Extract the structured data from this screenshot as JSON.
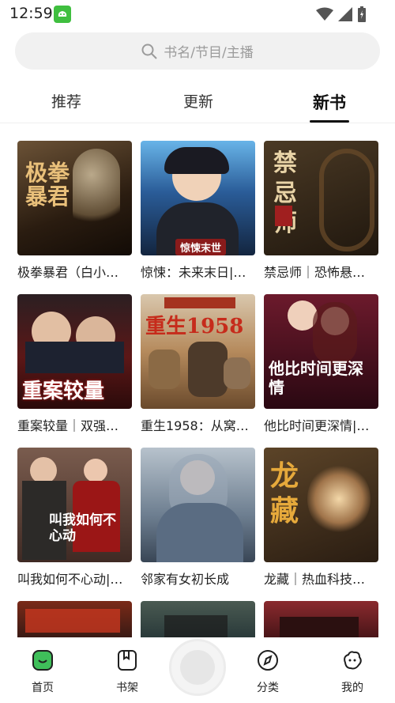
{
  "status": {
    "time": "12:59"
  },
  "search": {
    "placeholder": "书名/节目/主播"
  },
  "tabs": [
    {
      "label": "推荐"
    },
    {
      "label": "更新"
    },
    {
      "label": "新书"
    }
  ],
  "books": [
    {
      "title": "极拳暴君（白小…",
      "cover_text": "极拳暴君",
      "bg": "#3a2a1a"
    },
    {
      "title": "惊悚：未来末日|…",
      "cover_text": "惊悚末世",
      "bg": "#1d3c66"
    },
    {
      "title": "禁忌师｜恐怖悬…",
      "cover_text": "禁忌师",
      "bg": "#2b2218"
    },
    {
      "title": "重案较量｜双强…",
      "cover_text": "重案较量",
      "bg": "#3a1515"
    },
    {
      "title": "重生1958：从窝…",
      "cover_text": "重生1958",
      "bg": "#a97a4e"
    },
    {
      "title": "他比时间更深情|…",
      "cover_text": "他比时间更深情",
      "bg": "#4a1524"
    },
    {
      "title": "叫我如何不心动|…",
      "cover_text": "叫我如何不心动",
      "bg": "#5a3b3b"
    },
    {
      "title": "邻家有女初长成",
      "cover_text": "",
      "bg": "#6d7a8a"
    },
    {
      "title": "龙藏｜热血科技…",
      "cover_text": "龙藏",
      "bg": "#3b2a1c"
    },
    {
      "title": "",
      "cover_text": "",
      "bg": "#3a1a14"
    },
    {
      "title": "",
      "cover_text": "",
      "bg": "#2a3a3a"
    },
    {
      "title": "",
      "cover_text": "",
      "bg": "#6a1e22"
    }
  ],
  "nav": [
    {
      "label": "首页",
      "icon": "home-icon",
      "color": "#2ea84a"
    },
    {
      "label": "书架",
      "icon": "bookshelf-icon",
      "color": "#222222"
    },
    {
      "label": "分类",
      "icon": "compass-icon",
      "color": "#222222"
    },
    {
      "label": "我的",
      "icon": "profile-icon",
      "color": "#222222"
    }
  ]
}
